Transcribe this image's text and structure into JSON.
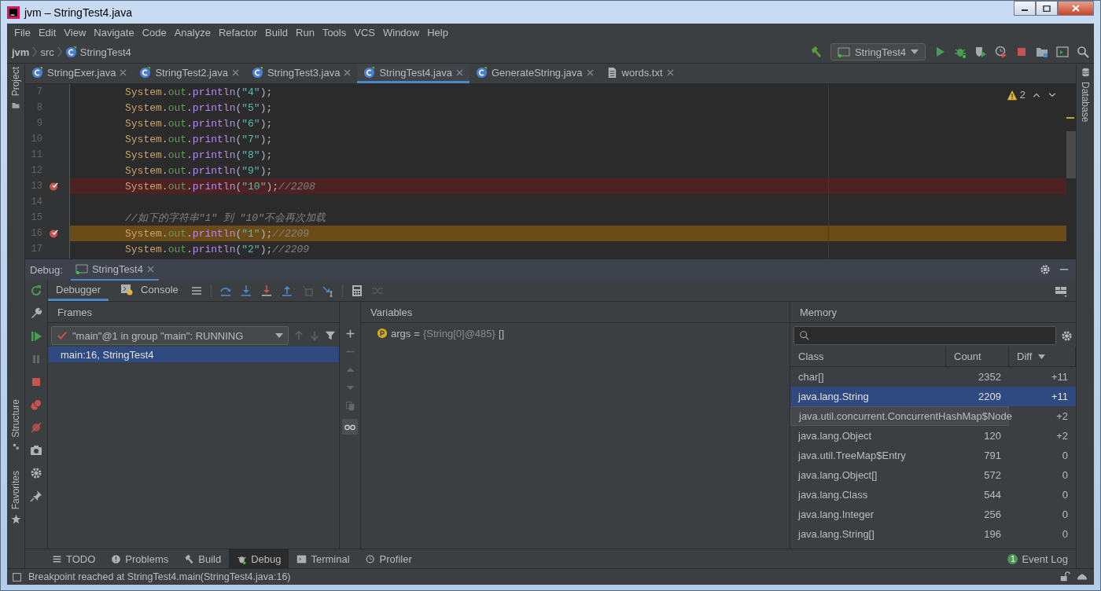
{
  "window": {
    "title": "jvm – StringTest4.java"
  },
  "menu": [
    "File",
    "Edit",
    "View",
    "Navigate",
    "Code",
    "Analyze",
    "Refactor",
    "Build",
    "Run",
    "Tools",
    "VCS",
    "Window",
    "Help"
  ],
  "breadcrumbs": [
    {
      "label": "jvm",
      "kind": "project"
    },
    {
      "label": "src",
      "kind": "folder"
    },
    {
      "label": "StringTest4",
      "kind": "class"
    }
  ],
  "run_config": "StringTest4",
  "side_tabs": {
    "project": "Project",
    "structure": "Structure",
    "favorites": "Favorites",
    "database": "Database"
  },
  "editor_tabs": [
    {
      "label": "StringExer.java",
      "kind": "class",
      "selected": false
    },
    {
      "label": "StringTest2.java",
      "kind": "class",
      "selected": false
    },
    {
      "label": "StringTest3.java",
      "kind": "class",
      "selected": false
    },
    {
      "label": "StringTest4.java",
      "kind": "class",
      "selected": true
    },
    {
      "label": "GenerateString.java",
      "kind": "class",
      "selected": false
    },
    {
      "label": "words.txt",
      "kind": "text",
      "selected": false
    }
  ],
  "editor": {
    "warnings": "2",
    "lines": [
      {
        "number": "7",
        "breakpoint": false,
        "kind": "plain",
        "tokens": [
          {
            "text": "System",
            "kind": "class"
          },
          {
            "text": ".",
            "kind": "plain"
          },
          {
            "text": "out",
            "kind": "field"
          },
          {
            "text": ".",
            "kind": "plain"
          },
          {
            "text": "println",
            "kind": "method"
          },
          {
            "text": "(",
            "kind": "plain"
          },
          {
            "text": "\"4\"",
            "kind": "string"
          },
          {
            "text": ");",
            "kind": "plain"
          }
        ]
      },
      {
        "number": "8",
        "breakpoint": false,
        "kind": "plain",
        "tokens": [
          {
            "text": "System",
            "kind": "class"
          },
          {
            "text": ".",
            "kind": "plain"
          },
          {
            "text": "out",
            "kind": "field"
          },
          {
            "text": ".",
            "kind": "plain"
          },
          {
            "text": "println",
            "kind": "method"
          },
          {
            "text": "(",
            "kind": "plain"
          },
          {
            "text": "\"5\"",
            "kind": "string"
          },
          {
            "text": ");",
            "kind": "plain"
          }
        ]
      },
      {
        "number": "9",
        "breakpoint": false,
        "kind": "plain",
        "tokens": [
          {
            "text": "System",
            "kind": "class"
          },
          {
            "text": ".",
            "kind": "plain"
          },
          {
            "text": "out",
            "kind": "field"
          },
          {
            "text": ".",
            "kind": "plain"
          },
          {
            "text": "println",
            "kind": "method"
          },
          {
            "text": "(",
            "kind": "plain"
          },
          {
            "text": "\"6\"",
            "kind": "string"
          },
          {
            "text": ");",
            "kind": "plain"
          }
        ]
      },
      {
        "number": "10",
        "breakpoint": false,
        "kind": "plain",
        "tokens": [
          {
            "text": "System",
            "kind": "class"
          },
          {
            "text": ".",
            "kind": "plain"
          },
          {
            "text": "out",
            "kind": "field"
          },
          {
            "text": ".",
            "kind": "plain"
          },
          {
            "text": "println",
            "kind": "method"
          },
          {
            "text": "(",
            "kind": "plain"
          },
          {
            "text": "\"7\"",
            "kind": "string"
          },
          {
            "text": ");",
            "kind": "plain"
          }
        ]
      },
      {
        "number": "11",
        "breakpoint": false,
        "kind": "plain",
        "tokens": [
          {
            "text": "System",
            "kind": "class"
          },
          {
            "text": ".",
            "kind": "plain"
          },
          {
            "text": "out",
            "kind": "field"
          },
          {
            "text": ".",
            "kind": "plain"
          },
          {
            "text": "println",
            "kind": "method"
          },
          {
            "text": "(",
            "kind": "plain"
          },
          {
            "text": "\"8\"",
            "kind": "string"
          },
          {
            "text": ");",
            "kind": "plain"
          }
        ]
      },
      {
        "number": "12",
        "breakpoint": false,
        "kind": "plain",
        "tokens": [
          {
            "text": "System",
            "kind": "class"
          },
          {
            "text": ".",
            "kind": "plain"
          },
          {
            "text": "out",
            "kind": "field"
          },
          {
            "text": ".",
            "kind": "plain"
          },
          {
            "text": "println",
            "kind": "method"
          },
          {
            "text": "(",
            "kind": "plain"
          },
          {
            "text": "\"9\"",
            "kind": "string"
          },
          {
            "text": ");",
            "kind": "plain"
          }
        ]
      },
      {
        "number": "13",
        "breakpoint": true,
        "kind": "breakpoint",
        "tokens": [
          {
            "text": "System",
            "kind": "class"
          },
          {
            "text": ".",
            "kind": "plain"
          },
          {
            "text": "out",
            "kind": "field"
          },
          {
            "text": ".",
            "kind": "plain"
          },
          {
            "text": "println",
            "kind": "method"
          },
          {
            "text": "(",
            "kind": "plain"
          },
          {
            "text": "\"10\"",
            "kind": "string"
          },
          {
            "text": ");",
            "kind": "plain"
          },
          {
            "text": "//2208",
            "kind": "comment"
          }
        ]
      },
      {
        "number": "14",
        "breakpoint": false,
        "kind": "plain"
      },
      {
        "number": "15",
        "breakpoint": false,
        "kind": "plain",
        "tokens": [
          {
            "text": "//如下的字符串\"1\" 到 \"10\"不会再次加载",
            "kind": "comment"
          }
        ]
      },
      {
        "number": "16",
        "breakpoint": true,
        "kind": "execution",
        "tokens": [
          {
            "text": "System",
            "kind": "class"
          },
          {
            "text": ".",
            "kind": "plain"
          },
          {
            "text": "out",
            "kind": "field"
          },
          {
            "text": ".",
            "kind": "plain"
          },
          {
            "text": "println",
            "kind": "method"
          },
          {
            "text": "(",
            "kind": "plain"
          },
          {
            "text": "\"1\"",
            "kind": "string"
          },
          {
            "text": ");",
            "kind": "plain"
          },
          {
            "text": "//2209",
            "kind": "comment"
          }
        ]
      },
      {
        "number": "17",
        "breakpoint": false,
        "kind": "plain",
        "tokens": [
          {
            "text": "System",
            "kind": "class"
          },
          {
            "text": ".",
            "kind": "plain"
          },
          {
            "text": "out",
            "kind": "field"
          },
          {
            "text": ".",
            "kind": "plain"
          },
          {
            "text": "println",
            "kind": "method"
          },
          {
            "text": "(",
            "kind": "plain"
          },
          {
            "text": "\"2\"",
            "kind": "string"
          },
          {
            "text": ");",
            "kind": "plain"
          },
          {
            "text": "//2209",
            "kind": "comment"
          }
        ]
      }
    ]
  },
  "debug": {
    "label": "Debug:",
    "session": "StringTest4",
    "tabs": [
      {
        "label": "Debugger",
        "kind": "debugger",
        "selected": true
      },
      {
        "label": "Console",
        "kind": "console",
        "selected": false
      }
    ],
    "frames": {
      "title": "Frames",
      "thread": "\"main\"@1 in group \"main\": RUNNING",
      "items": [
        {
          "label": "main:16, StringTest4",
          "selected": true
        }
      ]
    },
    "variables": {
      "title": "Variables",
      "items": [
        {
          "name": "args",
          "equals": "=",
          "value": "{String[0]@485}",
          "extra": "[]"
        }
      ]
    },
    "memory": {
      "title": "Memory",
      "columns": [
        "Class",
        "Count",
        "Diff"
      ],
      "rows": [
        {
          "class": "char[]",
          "count": "2352",
          "diff": "+11",
          "selected": false,
          "expanded": false
        },
        {
          "class": "java.lang.String",
          "count": "2209",
          "diff": "+11",
          "selected": true,
          "expanded": false
        },
        {
          "class": "java.util.concurrent.ConcurrentHashMap$Node",
          "diff": "+2",
          "selected": false,
          "expanded": true
        },
        {
          "class": "java.lang.Object",
          "count": "120",
          "diff": "+2",
          "selected": false,
          "expanded": false
        },
        {
          "class": "java.util.TreeMap$Entry",
          "count": "791",
          "diff": "0",
          "selected": false,
          "expanded": false
        },
        {
          "class": "java.lang.Object[]",
          "count": "572",
          "diff": "0",
          "selected": false,
          "expanded": false
        },
        {
          "class": "java.lang.Class",
          "count": "544",
          "diff": "0",
          "selected": false,
          "expanded": false
        },
        {
          "class": "java.lang.Integer",
          "count": "256",
          "diff": "0",
          "selected": false,
          "expanded": false
        },
        {
          "class": "java.lang.String[]",
          "count": "196",
          "diff": "0",
          "selected": false,
          "expanded": false
        }
      ]
    }
  },
  "tool_windows": [
    {
      "label": "TODO",
      "kind": "todo",
      "selected": false
    },
    {
      "label": "Problems",
      "kind": "problems",
      "selected": false
    },
    {
      "label": "Build",
      "kind": "build",
      "selected": false
    },
    {
      "label": "Debug",
      "kind": "debug",
      "selected": true
    },
    {
      "label": "Terminal",
      "kind": "terminal",
      "selected": false
    },
    {
      "label": "Profiler",
      "kind": "profiler",
      "selected": false
    }
  ],
  "event_log": {
    "count": "1",
    "label": "Event Log"
  },
  "status": "Breakpoint reached at StringTest4.main(StringTest4.java:16)"
}
